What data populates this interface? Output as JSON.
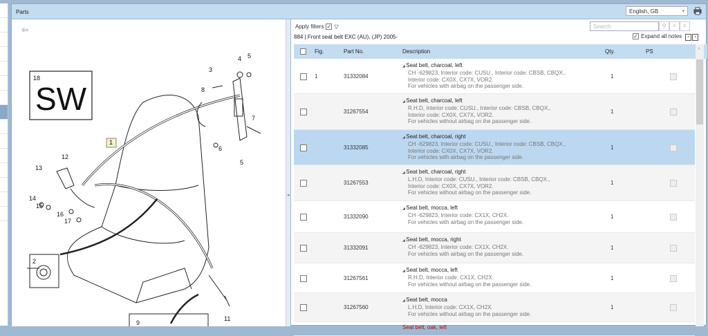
{
  "header": {
    "title": "Parts",
    "language": "English, GB"
  },
  "toolbar": {
    "apply_filters": "Apply filters",
    "apply_filters_checked": true,
    "search_placeholder": "Search",
    "expand_all_notes": "Expand all notes",
    "expand_checked": true
  },
  "section_title": "884  |  Front seat belt EXC (AU), (JP) 2005-",
  "columns": {
    "fig": "Fig.",
    "part_no": "Part No.",
    "description": "Description",
    "qty": "Qty.",
    "ps": "PS"
  },
  "rows": [
    {
      "fig": "1",
      "part_no": "31332084",
      "title": "Seat belt, charcoal, left",
      "notes": "CH -629823, Interior code: CUSU., Interior code: CBSB, CBQX., Interior code: CX0X, CX7X, VOR2.",
      "note2": "For vehicles with airbag on the passenger side.",
      "qty": "1"
    },
    {
      "fig": "",
      "part_no": "31267554",
      "title": "Seat belt, charcoal, left",
      "notes": "R.H.D, Interior code: CUSU., Interior code: CBSB, CBQX., Interior code: CX0X, CX7X, VOR2.",
      "note2": "For vehicles without airbag on the passenger side.",
      "qty": "1"
    },
    {
      "fig": "",
      "part_no": "31332085",
      "title": "Seat belt, charcoal, right",
      "notes": "CH -629823, Interior code: CUSU., Interior code: CBSB, CBQX., Interior code: CX0X, CX7X, VOR2.",
      "note2": "For vehicles with airbag on the passenger side.",
      "qty": "1"
    },
    {
      "fig": "",
      "part_no": "31267553",
      "title": "Seat belt, charcoal, right",
      "notes": "L.H.D, Interior code: CUSU., Interior code: CBSB, CBQX., Interior code: CX0X, CX7X, VOR2.",
      "note2": "For vehicles without airbag on the passenger side.",
      "qty": "1"
    },
    {
      "fig": "",
      "part_no": "31332090",
      "title": "Seat belt, mocca, left",
      "notes": "CH -629823, Interior code: CX1X, CH2X.",
      "note2": "For vehicles with airbag on the passenger side.",
      "qty": "1"
    },
    {
      "fig": "",
      "part_no": "31332091",
      "title": "Seat belt, mocca, right",
      "notes": "CH -629823, Interior code: CX1X, CH2X.",
      "note2": "For vehicles with airbag on the passenger side.",
      "qty": "1"
    },
    {
      "fig": "",
      "part_no": "31267561",
      "title": "Seat belt, mocca, left",
      "notes": "R.H.D, Interior code: CX1X, CH2X.",
      "note2": "For vehicles without airbag on the passenger side.",
      "qty": "1"
    },
    {
      "fig": "",
      "part_no": "31267560",
      "title": "Seat belt, mocca",
      "notes": "L.H.D, Interior code: CX1X, CH2X.",
      "note2": "For vehicles without airbag on the passenger side.",
      "qty": "1"
    }
  ],
  "partial_row": {
    "title": "Seat belt, oak, left"
  },
  "diagram": {
    "inset_number": "18",
    "inset_text": "SW",
    "callouts": [
      "1",
      "2",
      "3",
      "4",
      "5",
      "5",
      "6",
      "7",
      "8",
      "9",
      "11",
      "12",
      "13",
      "14",
      "15",
      "16",
      "17"
    ]
  }
}
